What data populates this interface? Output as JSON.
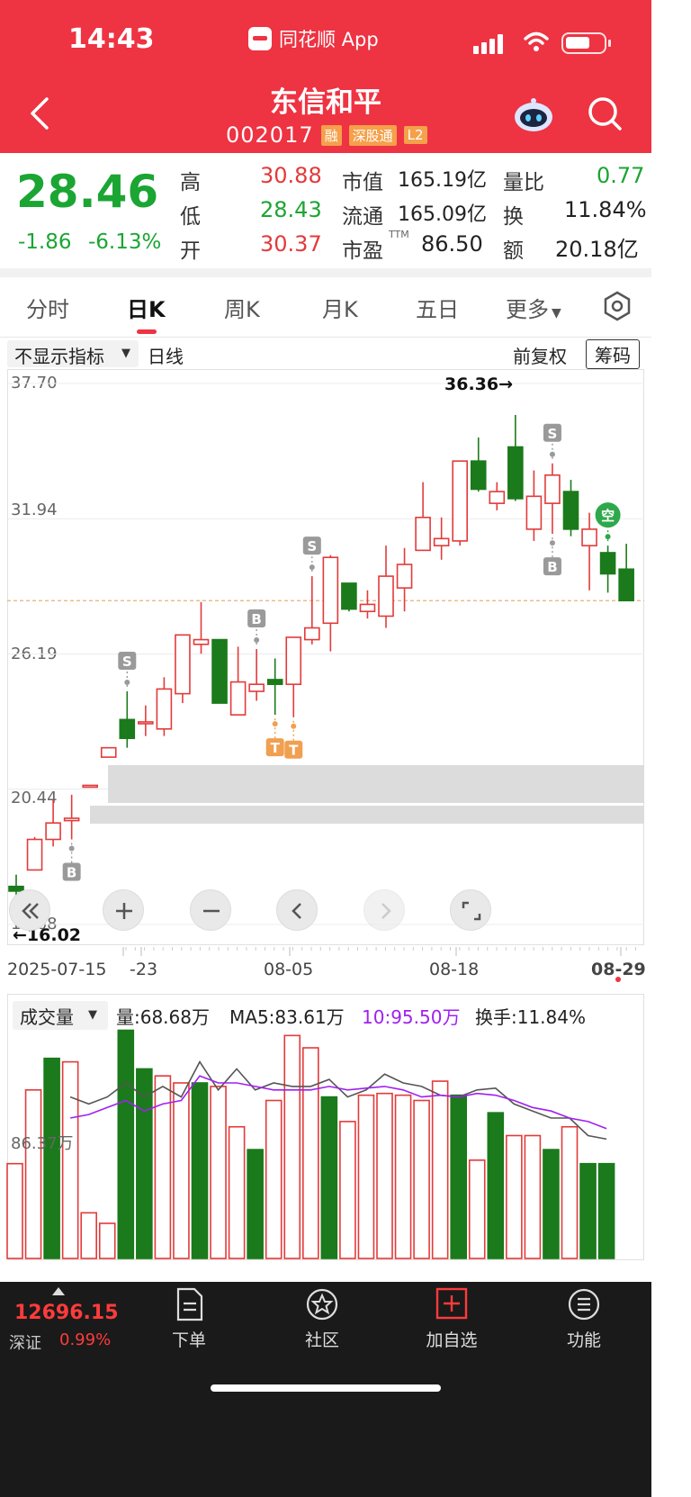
{
  "status_bar": {
    "time": "14:43",
    "app_label": "同花顺 App"
  },
  "header": {
    "title": "东信和平",
    "code": "002017",
    "tags": [
      "融",
      "深股通",
      "L2"
    ]
  },
  "quote": {
    "price": "28.46",
    "change": "-1.86",
    "change_pct": "-6.13%",
    "rows": [
      {
        "l1": "高",
        "v1": "30.88",
        "l2": "市值",
        "v2": "165.19亿",
        "l3": "量比",
        "v3": "0.77"
      },
      {
        "l1": "低",
        "v1": "28.43",
        "l2": "流通",
        "v2": "165.09亿",
        "l3": "换",
        "v3": "11.84%"
      },
      {
        "l1": "开",
        "v1": "30.37",
        "l2": "市盈",
        "v2": "86.50",
        "l3": "额",
        "v3": "20.18亿"
      }
    ],
    "pe_sup": "TTM"
  },
  "tabs": [
    "分时",
    "日K",
    "周K",
    "月K",
    "五日",
    "更多"
  ],
  "active_tab": "日K",
  "chart": {
    "indicator_label": "不显示指标",
    "period_label": "日线",
    "adjust_label": "前复权",
    "chip_button": "筹码",
    "y_ticks": [
      "37.70",
      "31.94",
      "26.19",
      "20.44",
      "14.68"
    ],
    "high_marker": "36.36→",
    "low_marker": "←16.02",
    "x_ticks": [
      "2025-07-15",
      "-23",
      "08-05",
      "08-18",
      "08-29"
    ]
  },
  "chart_data": {
    "type": "candlestick",
    "ylim": [
      14.68,
      37.7
    ],
    "y_ticks": [
      37.7,
      31.94,
      26.19,
      20.44,
      14.68
    ],
    "current_price_line": 28.46,
    "candles": [
      {
        "o": 16.3,
        "c": 16.1,
        "h": 16.8,
        "l": 15.8
      },
      {
        "o": 17.0,
        "c": 18.3,
        "h": 18.4,
        "l": 17.0
      },
      {
        "o": 18.3,
        "c": 19.0,
        "h": 20.0,
        "l": 18.0
      },
      {
        "o": 19.1,
        "c": 19.2,
        "h": 20.2,
        "l": 18.3
      },
      {
        "o": 20.6,
        "c": 20.6,
        "h": 20.6,
        "l": 20.6
      },
      {
        "o": 21.8,
        "c": 22.2,
        "h": 22.2,
        "l": 21.8
      },
      {
        "o": 23.4,
        "c": 22.6,
        "h": 24.6,
        "l": 22.2
      },
      {
        "o": 23.3,
        "c": 23.3,
        "h": 24.0,
        "l": 22.7
      },
      {
        "o": 23.0,
        "c": 24.7,
        "h": 25.2,
        "l": 22.7
      },
      {
        "o": 24.5,
        "c": 27.0,
        "h": 27.0,
        "l": 24.1
      },
      {
        "o": 26.6,
        "c": 26.8,
        "h": 28.4,
        "l": 26.2
      },
      {
        "o": 26.8,
        "c": 24.1,
        "h": 26.8,
        "l": 24.1
      },
      {
        "o": 23.6,
        "c": 25.0,
        "h": 26.5,
        "l": 23.6
      },
      {
        "o": 24.6,
        "c": 24.9,
        "h": 26.4,
        "l": 24.2
      },
      {
        "o": 25.1,
        "c": 24.9,
        "h": 26.0,
        "l": 23.6
      },
      {
        "o": 24.9,
        "c": 26.9,
        "h": 26.9,
        "l": 23.5
      },
      {
        "o": 26.8,
        "c": 27.3,
        "h": 29.5,
        "l": 26.6
      },
      {
        "o": 27.5,
        "c": 30.3,
        "h": 30.4,
        "l": 26.3
      },
      {
        "o": 29.2,
        "c": 28.1,
        "h": 29.2,
        "l": 28.0
      },
      {
        "o": 28.0,
        "c": 28.3,
        "h": 28.9,
        "l": 27.7
      },
      {
        "o": 27.8,
        "c": 29.5,
        "h": 30.8,
        "l": 27.3
      },
      {
        "o": 29.0,
        "c": 30.0,
        "h": 30.7,
        "l": 28.0
      },
      {
        "o": 30.6,
        "c": 32.0,
        "h": 33.5,
        "l": 30.6
      },
      {
        "o": 30.8,
        "c": 31.1,
        "h": 32.0,
        "l": 30.2
      },
      {
        "o": 31.0,
        "c": 34.4,
        "h": 34.4,
        "l": 30.8
      },
      {
        "o": 34.4,
        "c": 33.2,
        "h": 35.4,
        "l": 33.1
      },
      {
        "o": 32.6,
        "c": 33.1,
        "h": 33.5,
        "l": 32.3
      },
      {
        "o": 35.0,
        "c": 32.8,
        "h": 36.36,
        "l": 32.7
      },
      {
        "o": 31.5,
        "c": 32.9,
        "h": 34.0,
        "l": 31.0
      },
      {
        "o": 32.6,
        "c": 33.8,
        "h": 34.3,
        "l": 31.3
      },
      {
        "o": 33.1,
        "c": 31.5,
        "h": 33.6,
        "l": 31.2
      },
      {
        "o": 30.8,
        "c": 31.5,
        "h": 32.2,
        "l": 28.9
      },
      {
        "o": 30.5,
        "c": 29.6,
        "h": 30.8,
        "l": 28.8
      },
      {
        "o": 29.8,
        "c": 28.46,
        "h": 30.88,
        "l": 28.43
      }
    ],
    "signals": [
      {
        "idx": 3,
        "type": "B",
        "pos": "below"
      },
      {
        "idx": 6,
        "type": "S",
        "pos": "above"
      },
      {
        "idx": 13,
        "type": "B",
        "pos": "above"
      },
      {
        "idx": 14,
        "type": "T",
        "pos": "below"
      },
      {
        "idx": 15,
        "type": "T",
        "pos": "below"
      },
      {
        "idx": 16,
        "type": "S",
        "pos": "above"
      },
      {
        "idx": 29,
        "type": "S",
        "pos": "above"
      },
      {
        "idx": 29,
        "type": "B",
        "pos": "below"
      },
      {
        "idx": 32,
        "type": "空",
        "pos": "above"
      }
    ],
    "volume": {
      "label": "成交量",
      "readouts": [
        "量:68.68万",
        "MA5:83.61万",
        "10:95.50万",
        "换手:11.84%"
      ],
      "y_label": "86.37万",
      "bars": [
        54,
        96,
        114,
        112,
        26,
        20,
        130,
        108,
        104,
        100,
        100,
        98,
        75,
        62,
        90,
        127,
        120,
        92,
        78,
        93,
        94,
        93,
        90,
        101,
        93,
        56,
        83,
        70,
        70,
        62,
        75,
        54,
        54
      ],
      "bar_up": [
        true,
        true,
        false,
        true,
        true,
        true,
        false,
        false,
        true,
        true,
        false,
        true,
        true,
        false,
        true,
        true,
        true,
        false,
        true,
        true,
        true,
        true,
        true,
        true,
        false,
        true,
        false,
        true,
        true,
        false,
        true,
        false,
        false
      ],
      "ma5": [
        92,
        88,
        92,
        100,
        92,
        98,
        92,
        112,
        96,
        108,
        96,
        100,
        98,
        98,
        102,
        92,
        96,
        105,
        100,
        98,
        93,
        92,
        96,
        97,
        88,
        84,
        80,
        80,
        70,
        68
      ],
      "ma10": [
        80,
        82,
        86,
        90,
        84,
        88,
        90,
        104,
        100,
        100,
        98,
        96,
        96,
        96,
        98,
        96,
        97,
        98,
        96,
        92,
        93,
        92,
        94,
        93,
        90,
        86,
        84,
        80,
        78,
        74
      ]
    }
  },
  "bottom": {
    "index_value": "12696.15",
    "index_name": "深证",
    "index_change": "0.99%",
    "nav": [
      "下单",
      "社区",
      "加自选",
      "功能"
    ]
  }
}
